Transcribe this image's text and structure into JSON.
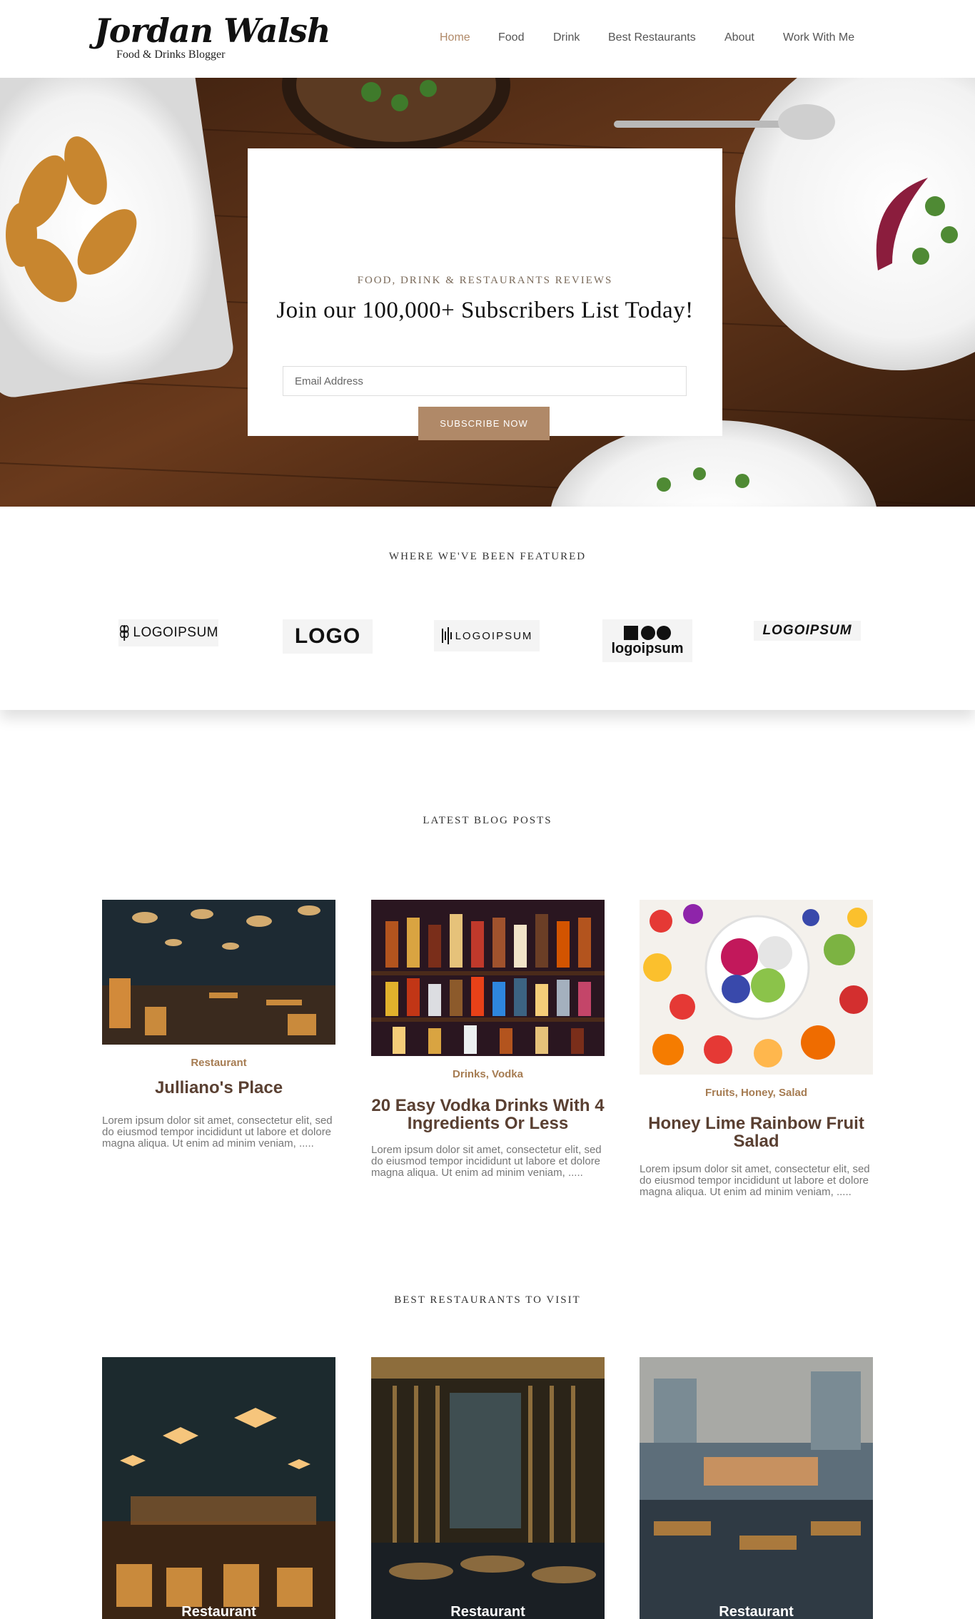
{
  "header": {
    "logo_name": "Jordan Walsh",
    "logo_tagline": "Food & Drinks Blogger",
    "nav": [
      "Home",
      "Food",
      "Drink",
      "Best Restaurants",
      "About",
      "Work With Me"
    ],
    "active_nav": "Home"
  },
  "hero": {
    "kicker": "FOOD, DRINK & RESTAURANTS REVIEWS",
    "title": "Join our 100,000+ Subscribers List Today!",
    "email_placeholder": "Email Address",
    "button_label": "SUBSCRIBE NOW"
  },
  "featured": {
    "heading": "WHERE WE'VE BEEN FEATURED",
    "logos": [
      "LOGOIPSUM",
      "LOGO",
      "LOGOIPSUM",
      "logoipsum",
      "LOGOIPSUM"
    ]
  },
  "blog": {
    "heading": "LATEST BLOG POSTS",
    "posts": [
      {
        "category": "Restaurant",
        "title": "Julliano's Place",
        "excerpt": "Lorem ipsum dolor sit amet, consectetur elit, sed do eiusmod tempor incididunt ut labore et dolore magna aliqua. Ut enim ad minim veniam, ....."
      },
      {
        "category": "Drinks, Vodka",
        "title": "20 Easy Vodka Drinks With 4 Ingredients Or Less",
        "excerpt": "Lorem ipsum dolor sit amet, consectetur elit, sed do eiusmod tempor incididunt ut labore et dolore magna aliqua. Ut enim ad minim veniam, ....."
      },
      {
        "category": "Fruits, Honey, Salad",
        "title": "Honey Lime Rainbow Fruit Salad",
        "excerpt": "Lorem ipsum dolor sit amet, consectetur elit, sed do eiusmod tempor incididunt ut labore et dolore magna aliqua. Ut enim ad minim veniam, ....."
      }
    ]
  },
  "restaurants": {
    "heading": "BEST RESTAURANTS TO VISIT",
    "cards": [
      {
        "label": "Restaurant"
      },
      {
        "label": "Restaurant"
      },
      {
        "label": "Restaurant"
      }
    ]
  },
  "colors": {
    "accent": "#b08968",
    "title_brown": "#5a4032",
    "category_brown": "#a67c52",
    "text_muted": "#777777"
  }
}
